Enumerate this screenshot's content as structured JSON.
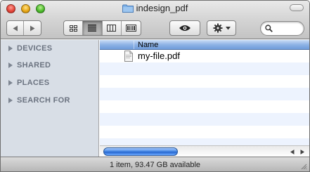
{
  "window": {
    "title": "indesign_pdf"
  },
  "toolbar": {
    "nav_back": "back-arrow",
    "nav_forward": "forward-arrow",
    "views": [
      "icon-view",
      "list-view",
      "column-view",
      "coverflow-view"
    ],
    "active_view": "list-view",
    "quicklook_icon": "eye-icon",
    "action_icon": "gear-icon",
    "search_placeholder": ""
  },
  "sidebar": {
    "sections": [
      {
        "label": "DEVICES"
      },
      {
        "label": "SHARED"
      },
      {
        "label": "PLACES"
      },
      {
        "label": "SEARCH FOR"
      }
    ]
  },
  "list": {
    "columns": [
      {
        "label": "Name"
      }
    ],
    "rows": [
      {
        "name": "my-file.pdf",
        "icon": "pdf-file-icon"
      }
    ]
  },
  "status": {
    "text": "1 item, 93.47 GB available"
  },
  "colors": {
    "header_blue": "#8fb4e6",
    "sidebar_bg": "#d8dee6",
    "alt_row": "#edf3fe",
    "scroll_thumb": "#2565cd"
  }
}
